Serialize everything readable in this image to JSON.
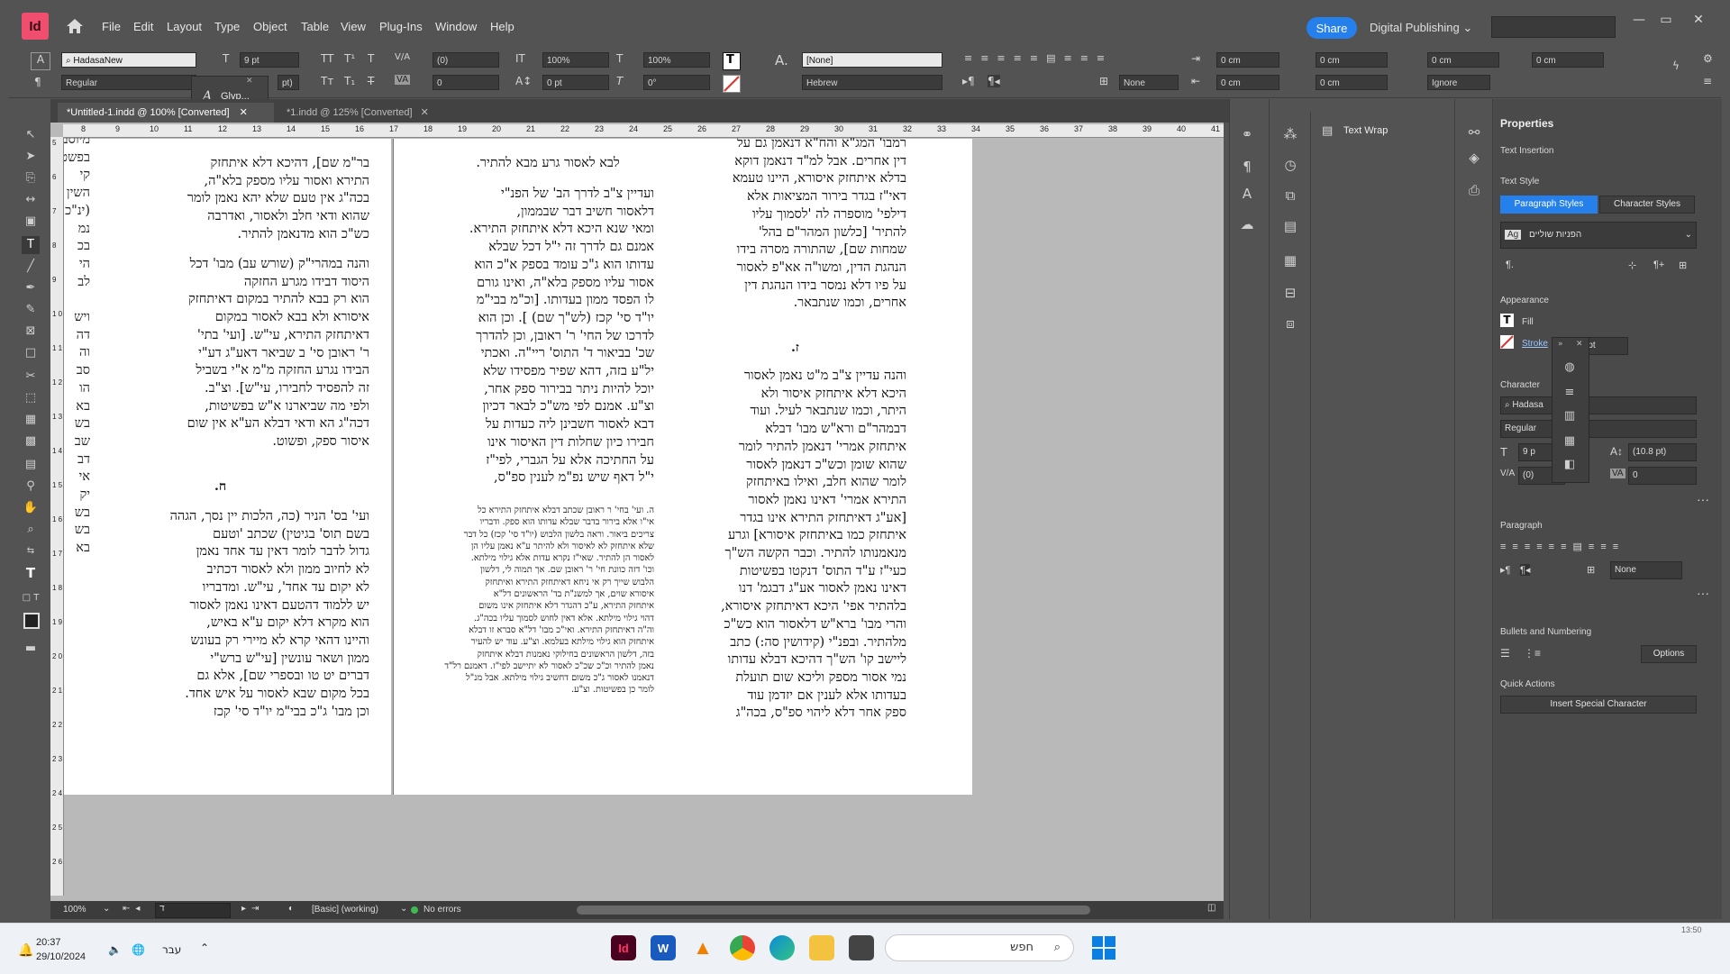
{
  "app": {
    "logo": "Id",
    "home_icon": "home-icon"
  },
  "menu": [
    "File",
    "Edit",
    "Layout",
    "Type",
    "Object",
    "Table",
    "View",
    "Plug-Ins",
    "Window",
    "Help"
  ],
  "topbar": {
    "share_label": "Share",
    "workspace_label": "Digital Publishing",
    "search_value": ""
  },
  "control_panel": {
    "font_family": "HadasaNew",
    "font_style": "Regular",
    "font_size": "9 pt",
    "leading": "pt)",
    "tracking": "(0)",
    "kerning": "0",
    "vertical_scale": "100%",
    "horizontal_scale": "100%",
    "baseline_shift": "0 pt",
    "skew": "0°",
    "char_style": "[None]",
    "language": "Hebrew",
    "indent_left": "0 cm",
    "indent_right": "0 cm",
    "first_line_indent": "0 cm",
    "last_line_indent": "0 cm",
    "space_before": "0 cm",
    "space_after": "0 cm",
    "drop_cap_lines": "0 cm",
    "drop_cap_chars": "0 cm",
    "hyphenation": "None",
    "grid_align": "Ignore"
  },
  "glyph_popup": {
    "label": "Glyp..."
  },
  "tabs": [
    {
      "label": "*Untitled-1.indd @ 100% [Converted]",
      "active": true
    },
    {
      "label": "*1.indd @ 125% [Converted]",
      "active": false
    }
  ],
  "ruler_h": [
    "8",
    "9",
    "10",
    "11",
    "12",
    "13",
    "14",
    "15",
    "16",
    "17",
    "18",
    "19",
    "20",
    "21",
    "22",
    "23",
    "24",
    "25",
    "26",
    "27",
    "28",
    "29",
    "30",
    "31",
    "32",
    "33",
    "34",
    "35",
    "36",
    "37",
    "38",
    "39",
    "40",
    "41"
  ],
  "ruler_v": [
    "5",
    "",
    "6",
    "",
    "7",
    "",
    "8",
    "",
    "9",
    "",
    "1 0",
    "",
    "1 1",
    "",
    "1 2",
    "",
    "1 3",
    "",
    "1 4",
    "",
    "1 5",
    "",
    "1 6",
    "",
    "1 7",
    "",
    "1 8",
    "",
    "1 9",
    "",
    "2 0",
    "",
    "2 1",
    "",
    "2 2",
    "",
    "2 3",
    "",
    "2 4",
    "",
    "2 5",
    "",
    "2 6",
    "",
    "2 7",
    "",
    "2 8"
  ],
  "document": {
    "leftcut_column": "מיוסב בפשטות קי השין (ינ\"כ\nנמ\nבכ\nהי\nלב\n\nויש\nדה\nוה\nסב\nהו\nבא\nבש\nשב\nדב\nאי\nיק\nבש\nבש\nבא",
    "page1_col_a": "בר\"מ שם], דהיכא דלא איתחזק\nהתירא ואסור עליו מספק בלא\"ה,\nבכה\"ג אין טעם שלא יהא נאמן לומר\nשהוא ודאי חלב ולאסור, ואדרבה\nכש\"כ הוא מדנאמן להתיר.",
    "page1_col_b": "והנה במהרי\"ק (שורש עב) מבו' דכל\nהיסוד דבידו מגרע החזקה\nהוא רק בבא להתיר במקום דאיתחזק\nאיסורא ולא בבא לאסור במקום\nדאיתחזק התירא, עי\"ש. [ועי' בתי'\nר' ראובן סי' ב שביאר דאע\"ג דע\"י\nהבידו נגרע החזקה מ\"מ א\"י בשביל\nזה להפסיד לחבירו, עי\"ש]. וצ\"ב.\nולפי מה שביארנו א\"ש בפשיטות,\nדכה\"ג הא ודאי דבלא הע\"א אין שום\nאיסור ספק, ופשוט.",
    "page1_heading_h": "ח.",
    "page1_col_c": "ועי' בס' הניר (כה, הלכות יין נסך, הגהה\nבשם תוס' בגיטין) שכתב 'וטעם\nגדול לדבר לומר דאין עד אחד נאמן\nלא לחיוב ממון ולא לאסור דכתיב\nלא יקום עד אחד', עי\"ש. ומדבריו\nיש ללמוד דהטעם דאינו נאמן לאסור\nהוא מקרא דלא יקום ע\"א באיש,\nוהיינו דהאי קרא לא מיירי רק בעונש\nממון ושאר עונשין [עי\"ש ברש\"י\nדברים יט טו ובספרי שם], אלא גם\nבכל מקום שבא לאסור על איש אחד.\nוכן מבו' ג\"כ בבי\"מ יו\"ד סי' קכז",
    "page2_top": "לבא לאסור גרע מבא להתיר.",
    "page2_col": "ועדיין צ\"ב לדרך הב' של הפנ\"י\nדלאסור חשיב דבר שבממון,\nומאי שנא היכא דלא איתחזק התירא.\nאמנם גם לדרך זה י\"ל דכל שבלא\nעדותו הוא ג\"כ עומד בספק א\"כ הוא\nאסור עליו מספק בלא\"ה, ואינו גורם\nלו הפסד ממון בעדותו. [וכ\"מ בבי\"מ\nיו\"ד סי' קכז (לש\"ך שם) ]. וכן הוא\nלדרכו של החי' ר' ראובן, וכן להדרך\nשכ' בביאור ד' התוס' ריי\"ה. ואכתי\nיל\"ע בזה, דהא שפיר מפסידו שלא\nיוכל להיות ניתר בבירור ספק אחר,\nוצ\"ע. אמנם לפי מש\"כ לבאר דכיון\nדבא לאסור חשבינן ליה כעדות על\nחבירו כיון שחלות דין האיסור אינו\nעל החתיכה אלא על הגברי, לפי\"ז\nי\"ל דאף שיש נפ\"מ לענין ספ\"ס,",
    "page2_footnote": "ה. ועי' בחי' ר ראובן שכתב דבלא איתחזק התירא כל\nאי\"ו אלא בירור בדבר שבלא עדותו הוא ספק. ודבריו\nצריכים ביאור. וראה בלשון הלבוש (יו\"ד סי' קכז) כל דבר\nשלא איתחזק לא לאיסור ולא להיתר ע\"א נאמן עליו הן\nלאסור הן להתיר. שאי\"ז נקרא עדות אלא גילוי מילתא.\nוכו' דזה כוונת חי' ר' ראובן שם. אך תמוה לי, דלשון\nהלבוש שייך רק אי ניחא דאיתחזק התירא ואיתחזק\nאיסורא שוים, אך למשנ\"ת בד' הראשונים דל\"א\nאיתחזק התירא, ע\"כ דהגדר דלא איתחזק אינו משום\nדהוי גילוי מילתא. אלא דאין לחוש לסמוך עליו בכה\"ג.\nוה\"ה דאיתחזק התירא. ואי\"כ מבו' דל\"א סברא זו דבלא\nאיתחזק הוא גילוי מילתא בעלמא. וצ\"ע. עוד יש להעיר\nבזה, דלשון הראשונים בחילוקי נאמנות דבלא איתחזק\nנאמן להתיר וכ\"כ שכ\"כ לאסור לא יתיישב לפי\"ז. דאמנם רל\"ד\nדנאמנו לאסור ג\"כ משום דחשיב גילוי מילתא. אבל מנ\"ל\nלומר כן בפשיטות. וצ\"ע.",
    "page3_col_a": "רמבו' המג\"א והח\"א דנאמן גם על\nדין אחרים. אבל למ\"ד דנאמן דוקא\nבדלא איתחזק איסורא, היינו טעמא\nדאי\"ז בגדר בירור המציאות אלא\nדילפי' מוספרה לה 'לסמוך עליו\nלהתיר' [כלשון המהר\"ם בהל'\nשמחות שם], שהתורה מסרה בידו\nהנהגת הדין, ומשו\"ה אא\"פ לאסור\nעל פיו דלא נמסר בידו הנהגת דין\nאחרים, וכמו שנתבאר.",
    "page3_heading_z": "ז.",
    "page3_col_b": "והנה עדיין צ\"ב מ\"ט נאמן לאסור\nהיכא דלא איתחזק איסור ולא\nהיתר, וכמו שנתבאר לעיל. ועוד\nדבמהר\"ם ורא\"ש מבו' דבלא\nאיתחזק אמרי' דנאמן להתיר לומר\nשהוא שומן וכש\"כ דנאמן לאסור\nלומר שהוא חלב, ואילו באיתחזק\nהתירא אמרי' דאינו נאמן לאסור\n[אע\"ג דאיתחזק התירא אינו בגדר\nאיתחזק כמו באיתחזק איסורא] וגרע\nמנאמנותו להתיר. וכבר הקשה הש\"ך\nכעי\"ז ע\"ד התוס' דנקטו בפשיטות\nדאינו נאמן לאסור אע\"ג דבגמ' דנו\nבלהתיר אפי' היכא דאיתחזק איסורא,\nוהרי מבו' ברא\"ש דלאסור הוא כש\"כ\nמלהתיר. ובפנ\"י (קידושין סה:) כתב\nליישב קו' הש\"ך דהיכא דבלא עדותו\nנמי אסור מספק וליכא שום תועלת\nבעדותו אלא לענין אם יזדמן עוד\nספק אחר דלא ליהוי ספ\"ס, בכה\"ג"
  },
  "status": {
    "zoom": "100%",
    "page": "ד",
    "style": "[Basic] (working)",
    "preflight": "No errors"
  },
  "textwrap_panel": {
    "title": "Text Wrap"
  },
  "properties": {
    "title": "Properties",
    "text_insertion": "Text Insertion",
    "text_style": "Text Style",
    "tab_paragraph": "Paragraph Styles",
    "tab_character": "Character Styles",
    "paragraph_style_value": "הפניות שוליים",
    "appearance": "Appearance",
    "fill_label": "Fill",
    "stroke_label": "Stroke",
    "stroke_weight": "0 pt",
    "character": "Character",
    "char_font": "Hadasa",
    "char_style": "Regular",
    "char_size": "9 p",
    "char_leading": "(10.8 pt)",
    "char_kerning": "(0)",
    "char_tracking": "0",
    "paragraph": "Paragraph",
    "para_hyphen": "None",
    "bullets": "Bullets and Numbering",
    "options_label": "Options",
    "quick_actions": "Quick Actions",
    "insert_special": "Insert Special Character"
  },
  "taskbar": {
    "time": "20:37",
    "date": "29/10/2024",
    "lang": "עבר",
    "search_placeholder": "חפש",
    "corner_time": "13:50"
  },
  "colors": {
    "accent": "#2680eb",
    "indesign": "#f04e6e"
  }
}
